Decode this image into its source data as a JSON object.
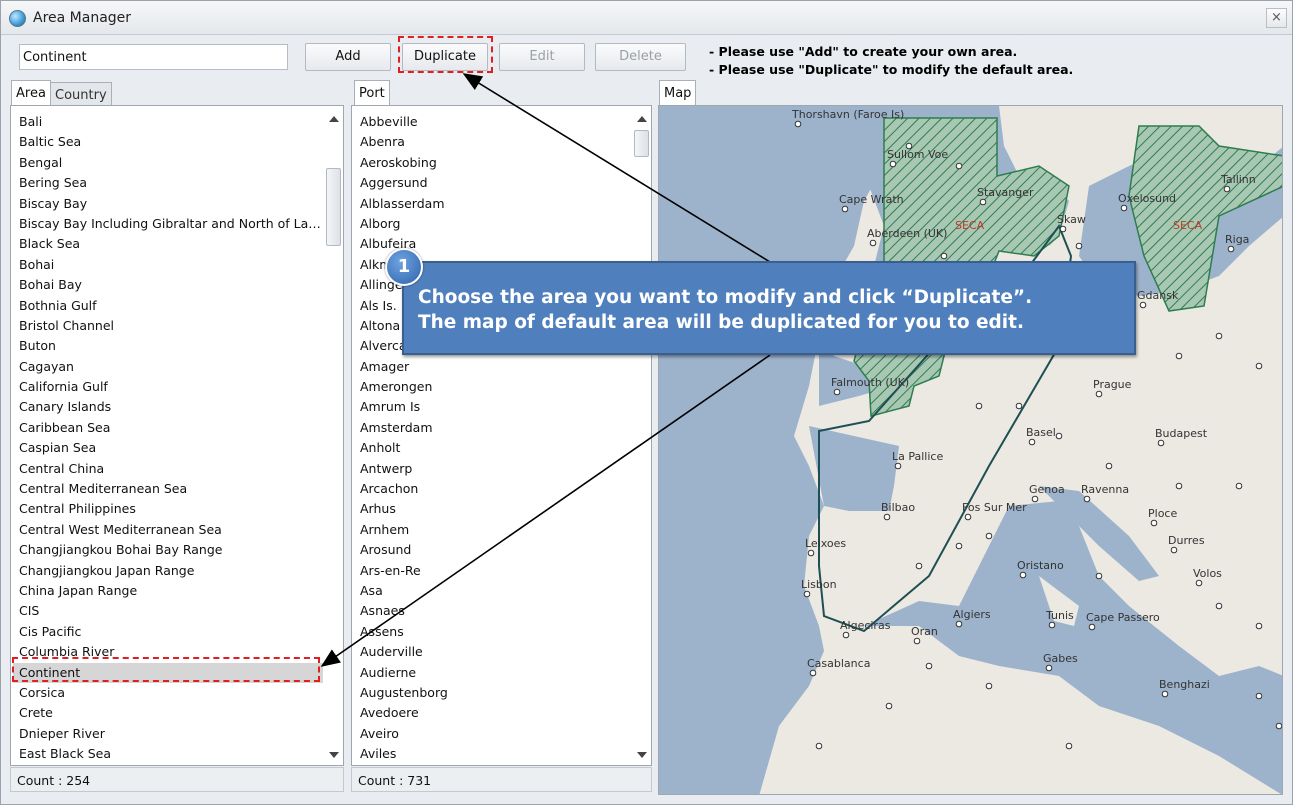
{
  "window": {
    "title": "Area Manager",
    "close_glyph": "×"
  },
  "toolbar": {
    "area_name_value": "Continent",
    "add_label": "Add",
    "duplicate_label": "Duplicate",
    "edit_label": "Edit",
    "delete_label": "Delete",
    "instruction_line1": "- Please use \"Add\" to create your own area.",
    "instruction_line2": "- Please use \"Duplicate\" to modify the default area."
  },
  "area_panel": {
    "tabs": [
      {
        "label": "Area"
      },
      {
        "label": "Country"
      }
    ],
    "items": [
      "Bali",
      "Baltic Sea",
      "Bengal",
      "Bering Sea",
      "Biscay Bay",
      "Biscay Bay Including Gibraltar and North of Laay…",
      "Black Sea",
      "Bohai",
      "Bohai Bay",
      "Bothnia Gulf",
      "Bristol Channel",
      "Buton",
      "Cagayan",
      "California Gulf",
      "Canary Islands",
      "Caribbean Sea",
      "Caspian Sea",
      "Central China",
      "Central Mediterranean Sea",
      "Central Philippines",
      "Central West Mediterranean Sea",
      "Changjiangkou Bohai Bay Range",
      "Changjiangkou Japan Range",
      "China Japan Range",
      "CIS",
      "Cis Pacific",
      "Columbia River",
      "Continent",
      "Corsica",
      "Crete",
      "Dnieper River",
      "East Black Sea"
    ],
    "selected_item": "Continent",
    "count_label": "Count : 254"
  },
  "port_panel": {
    "tab_label": "Port",
    "items": [
      "Abbeville",
      "Abenra",
      "Aeroskobing",
      "Aggersund",
      "Alblasserdam",
      "Alborg",
      "Albufeira",
      "Alkmaar",
      "Allinge",
      "Als Is.",
      "Altona",
      "Alverca",
      "Amager",
      "Amerongen",
      "Amrum Is",
      "Amsterdam",
      "Anholt",
      "Antwerp",
      "Arcachon",
      "Arhus",
      "Arnhem",
      "Arosund",
      "Ars-en-Re",
      "Asa",
      "Asnaes",
      "Assens",
      "Auderville",
      "Audierne",
      "Augustenborg",
      "Avedoere",
      "Aveiro",
      "Aviles"
    ],
    "count_label": "Count : 731"
  },
  "map_panel": {
    "tab_label": "Map",
    "city_labels": [
      "Thorshavn (Faroe Is)",
      "Sullom Voe",
      "Cape Wrath",
      "Stavanger",
      "Oxelosund",
      "Tallinn",
      "Aberdeen (UK)",
      "Skaw",
      "Riga",
      "Gdansk",
      "Falmouth (UK)",
      "Prague",
      "Basel",
      "Budapest",
      "La Pallice",
      "Genoa",
      "Ravenna",
      "Bilbao",
      "Fos Sur Mer",
      "Ploce",
      "Leixoes",
      "Durres",
      "Oristano",
      "Volos",
      "Lisbon",
      "Algiers",
      "Tunis",
      "Cape Passero",
      "Algeciras",
      "Oran",
      "Casablanca",
      "Gabes",
      "Benghazi"
    ],
    "seca_labels": [
      "SECA",
      "SECA"
    ]
  },
  "callout": {
    "badge": "1",
    "line1": "Choose the area you want to modify and click “Duplicate”.",
    "line2": "The map of default area will be duplicated for you to edit."
  },
  "colors": {
    "callout_bg": "#4f7fbd",
    "highlight": "#e02020",
    "sea": "#9db3cc",
    "seca": "#2e7d4f"
  }
}
